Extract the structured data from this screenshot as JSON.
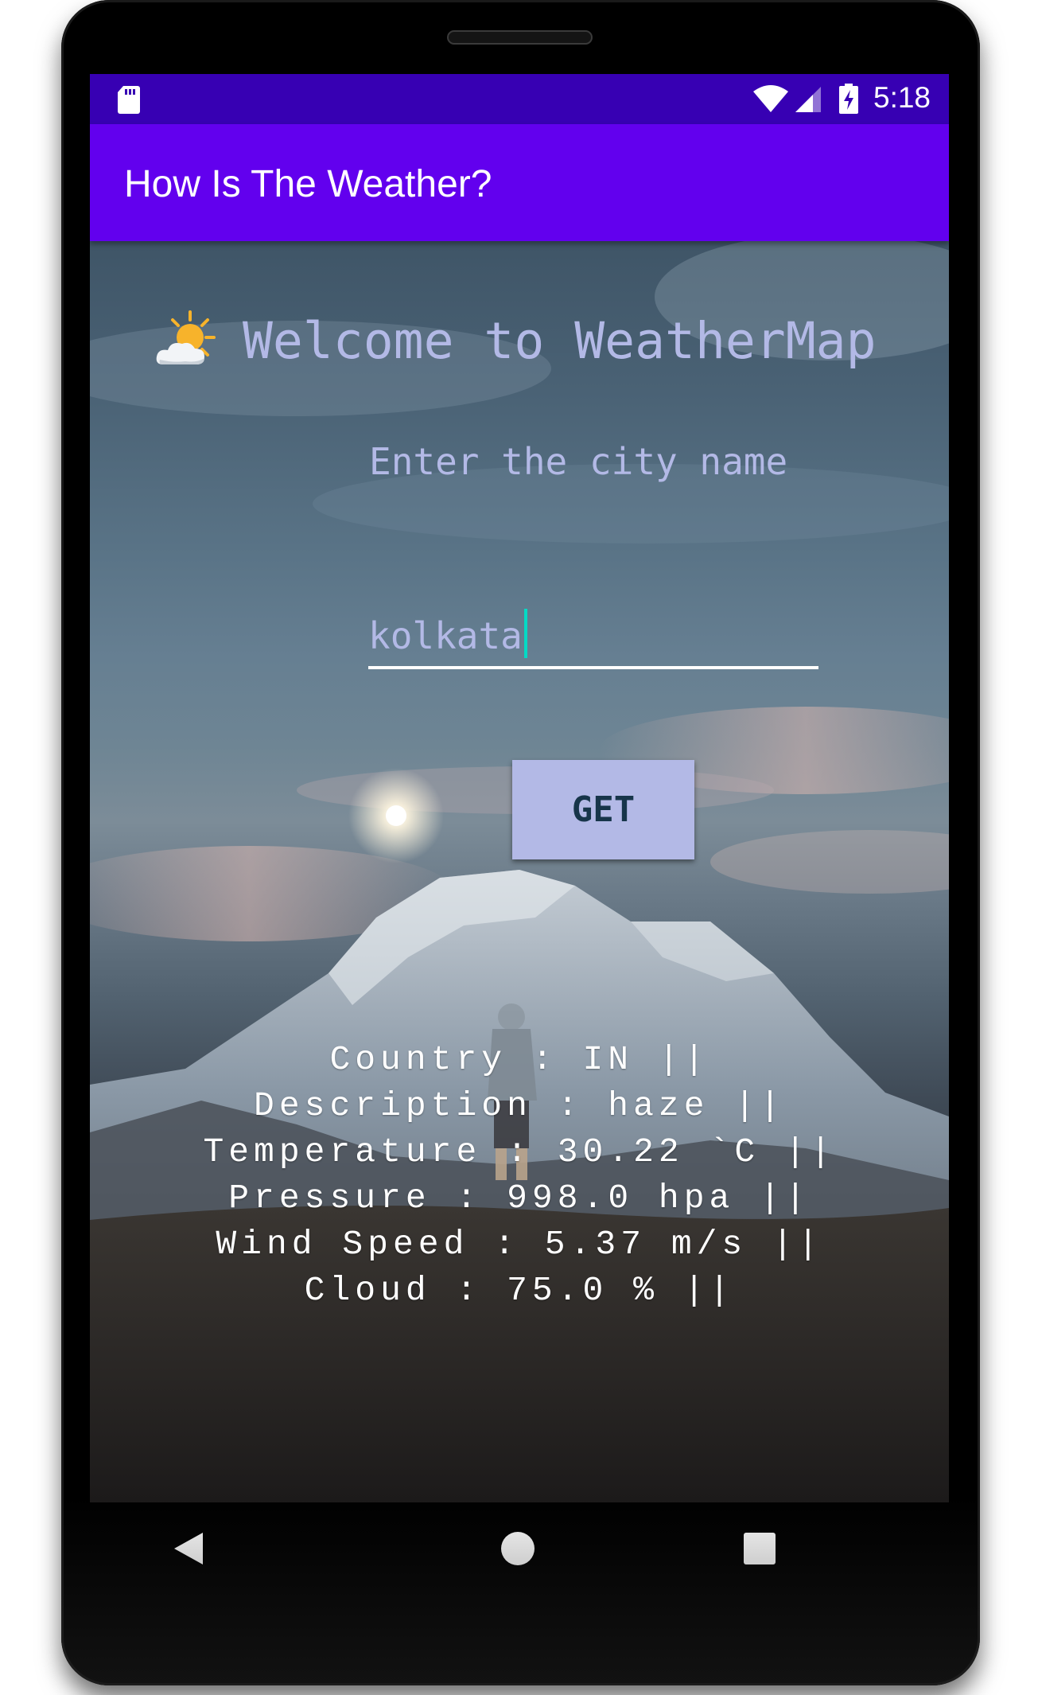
{
  "status_bar": {
    "time": "5:18",
    "icons": [
      "sd-card-icon",
      "wifi-icon",
      "signal-icon",
      "battery-charging-icon"
    ]
  },
  "app_bar": {
    "title": "How Is The Weather?",
    "color": "#6200ee"
  },
  "main": {
    "icon": "sun-behind-cloud-icon",
    "welcome": "Welcome to WeatherMap",
    "prompt": "Enter the city name",
    "city_input": {
      "value": "kolkata",
      "placeholder": ""
    },
    "get_button": "GET",
    "results": [
      "Country : IN ||",
      "Description : haze ||",
      "Temperature : 30.22 `C ||",
      "Pressure : 998.0 hpa ||",
      "Wind Speed : 5.37 m/s ||",
      "Cloud : 75.0 % ||"
    ]
  },
  "nav_bar": {
    "buttons": [
      "back-icon",
      "home-icon",
      "recents-icon"
    ]
  },
  "colors": {
    "status_bar": "#3700b3",
    "app_bar": "#6200ee",
    "accent": "#03dac5",
    "button_bg": "#b3b9e6",
    "text_light": "#b3b9e6"
  }
}
